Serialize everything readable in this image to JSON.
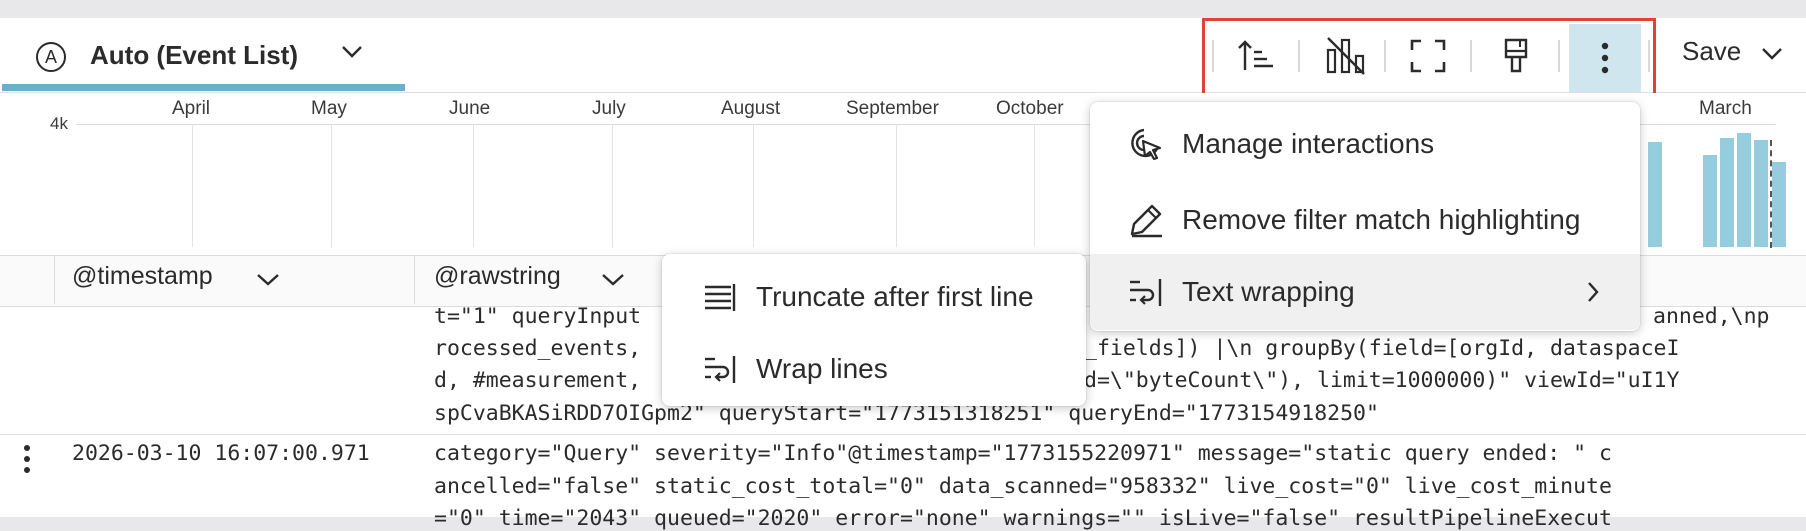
{
  "toolbar": {
    "visualization_label": "Auto (Event List)",
    "visualization_icon": "circle-a-icon",
    "save_label": "Save",
    "buttons": [
      "sort-ascending-icon",
      "hide-chart-icon",
      "fullscreen-icon",
      "paint-brush-icon",
      "more-vertical-icon"
    ],
    "highlight_color": "#e2413a",
    "accent_color": "#67b1cf"
  },
  "timeline": {
    "y_tick": "4k",
    "months": [
      "April",
      "May",
      "June",
      "July",
      "August",
      "September",
      "October",
      "March"
    ],
    "bar_color": "#95cddf"
  },
  "table": {
    "columns": [
      "@timestamp",
      "@rawstring"
    ],
    "rows": [
      {
        "timestamp": "",
        "lines": [
          "t=\"1\" queryInput",
          "rocessed_events,",
          "d, #measurement,",
          "spCvaBKASiRDD7OIGpm2\" queryStart=\"1773151318251\" queryEnd=\"1773154918250\""
        ],
        "line_tails": [
          "anned,\\np",
          "_fields]) |\\n groupBy(field=[orgId, dataspaceI",
          "d=\\\"byteCount\\\"), limit=1000000)\" viewId=\"uI1Y",
          ""
        ]
      },
      {
        "timestamp": "2026-03-10 16:07:00.971",
        "lines": [
          "category=\"Query\" severity=\"Info\"@timestamp=\"1773155220971\" message=\"static query ended: \" c",
          "ancelled=\"false\" static_cost_total=\"0\" data_scanned=\"958332\" live_cost=\"0\" live_cost_minute",
          "=\"0\" time=\"2043\" queued=\"2020\" error=\"none\" warnings=\"\" isLive=\"false\" resultPipelineExecut"
        ]
      }
    ]
  },
  "more_menu": {
    "items": [
      {
        "label": "Manage interactions",
        "icon": "cursor-click-icon"
      },
      {
        "label": "Remove filter match highlighting",
        "icon": "eraser-pen-icon"
      },
      {
        "label": "Text wrapping",
        "icon": "text-wrap-icon",
        "submenu_icon": "chevron-right-icon"
      }
    ]
  },
  "wrap_menu": {
    "items": [
      {
        "label": "Truncate after first line",
        "icon": "truncate-lines-icon"
      },
      {
        "label": "Wrap lines",
        "icon": "wrap-lines-icon"
      }
    ]
  }
}
